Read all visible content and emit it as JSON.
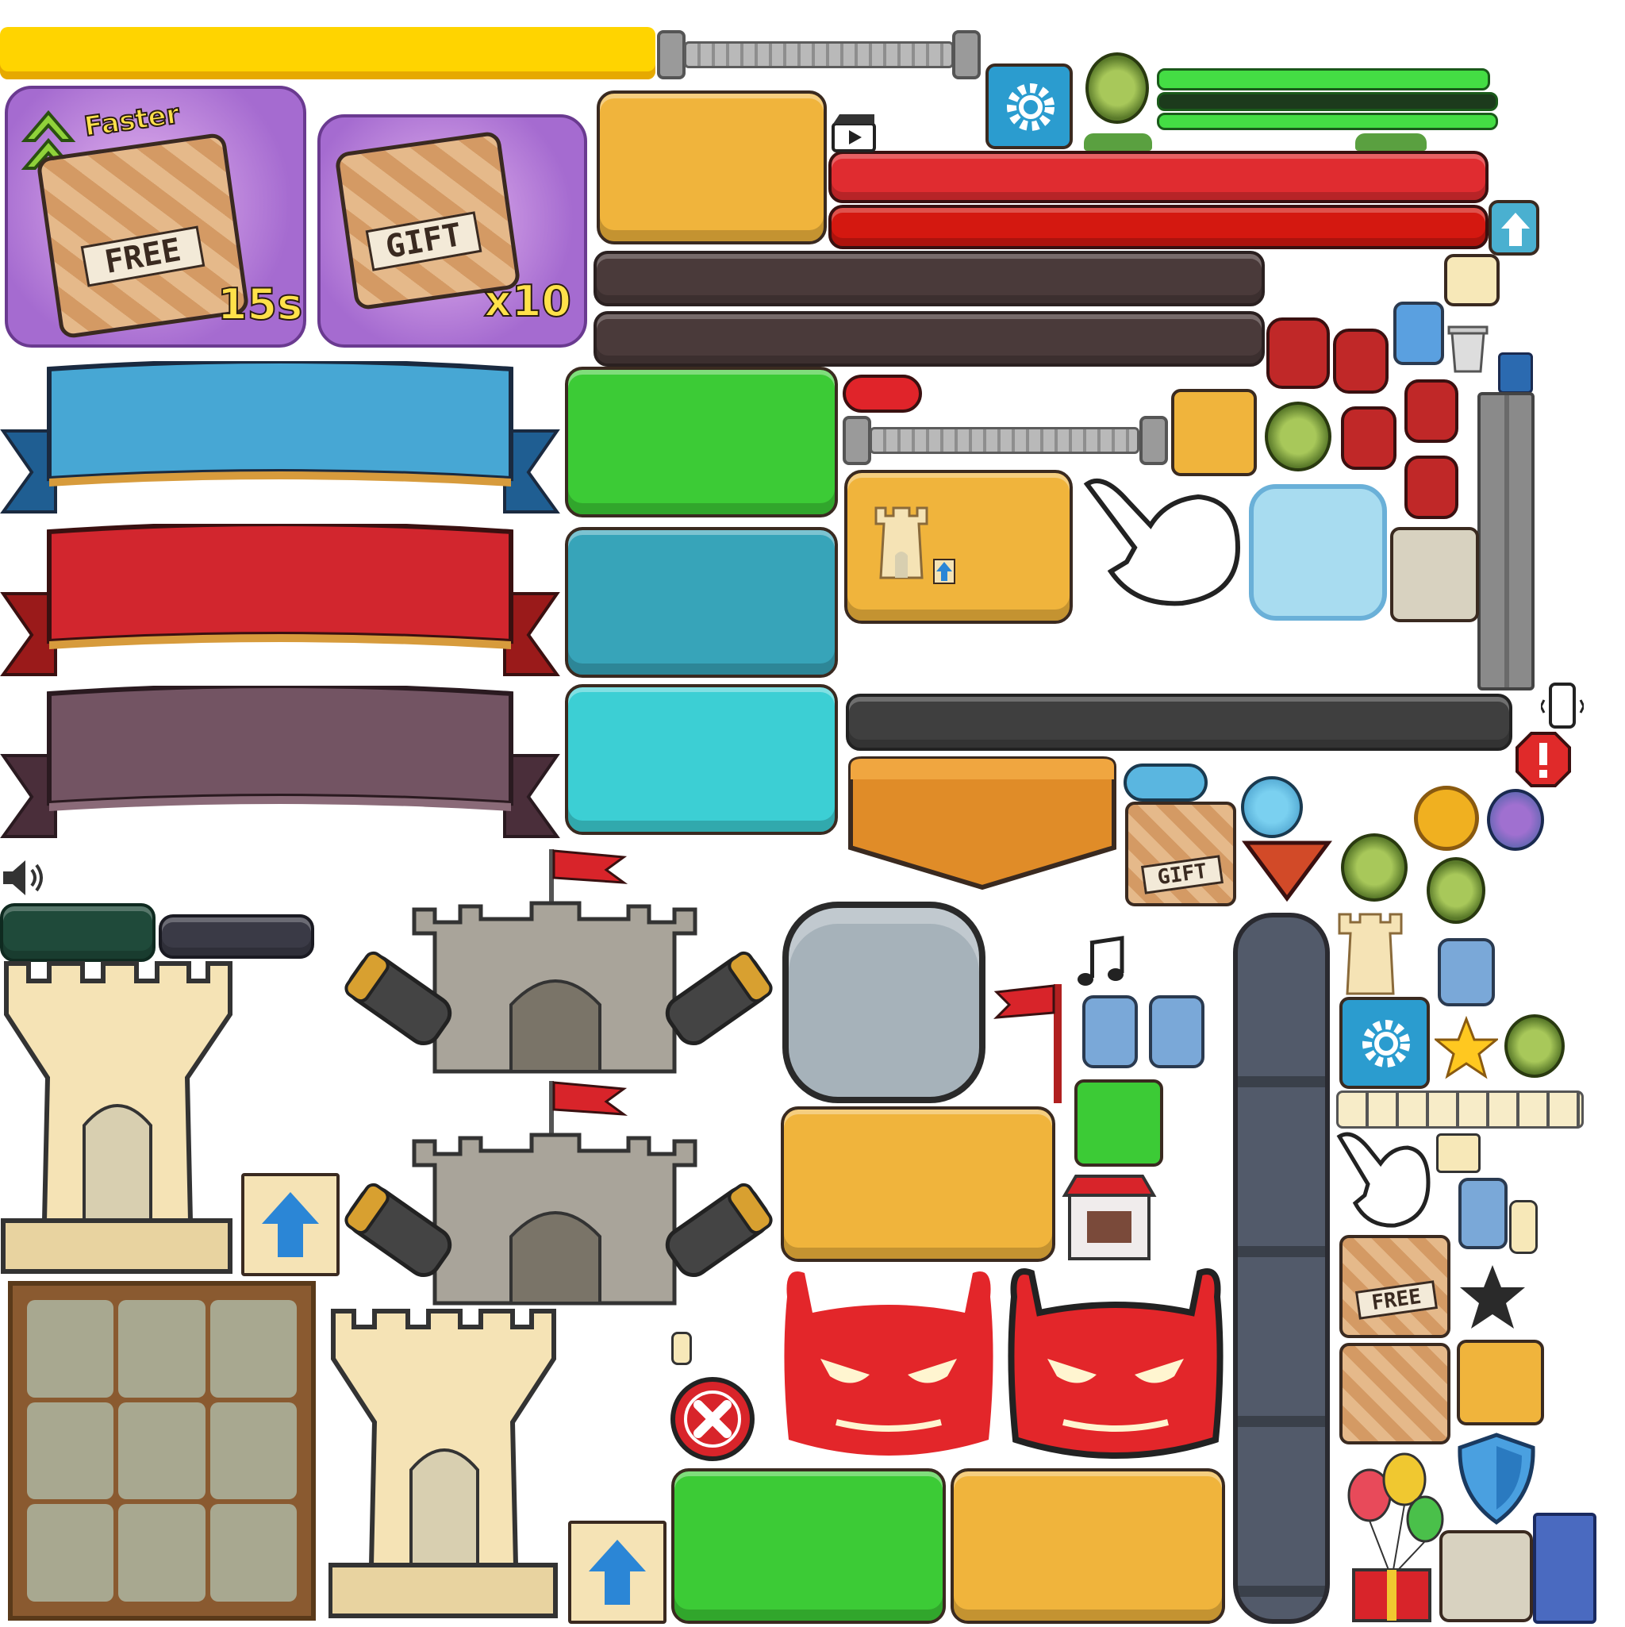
{
  "cards": {
    "free": {
      "tag": "Faster",
      "label": "FREE",
      "timer": "15s"
    },
    "gift": {
      "label": "GIFT",
      "count": "x10"
    }
  },
  "small_boxes": {
    "gift": "GIFT",
    "free": "FREE"
  },
  "icons": [
    "gear-icon",
    "speaker-icon",
    "music-icon",
    "play-video-icon",
    "up-arrow-icon",
    "warning-icon",
    "close-icon",
    "coin-icon",
    "star-icon",
    "shield-icon",
    "hand-pointer-icon",
    "trash-icon",
    "shop-icon",
    "balloons-gift-icon",
    "flag-icon"
  ],
  "colors": {
    "gold": "#f0b43c",
    "green": "#3ccb36",
    "teal": "#37a4b9",
    "cyan": "#3ccfd4",
    "red": "#d92b2b",
    "ribbon_blue": "#47a7d4",
    "ribbon_red": "#d2262e",
    "ribbon_purple": "#735463",
    "dark_bar": "#4a3a3a",
    "devil_red": "#e3262a",
    "yellow_bar": "#ffd400"
  }
}
